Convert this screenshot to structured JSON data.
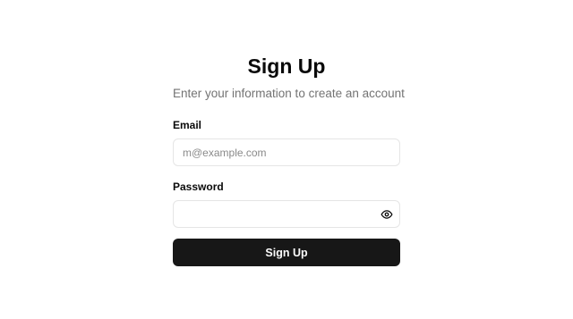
{
  "form": {
    "title": "Sign Up",
    "subtitle": "Enter your information to create an account",
    "email": {
      "label": "Email",
      "placeholder": "m@example.com",
      "value": ""
    },
    "password": {
      "label": "Password",
      "placeholder": "",
      "value": "",
      "toggle_icon": "eye-icon"
    },
    "submit_label": "Sign Up"
  },
  "colors": {
    "background": "#ffffff",
    "text": "#0a0a0a",
    "muted_text": "#737373",
    "input_border": "#e5e5e5",
    "button_bg": "#171717",
    "button_text": "#fafafa"
  }
}
